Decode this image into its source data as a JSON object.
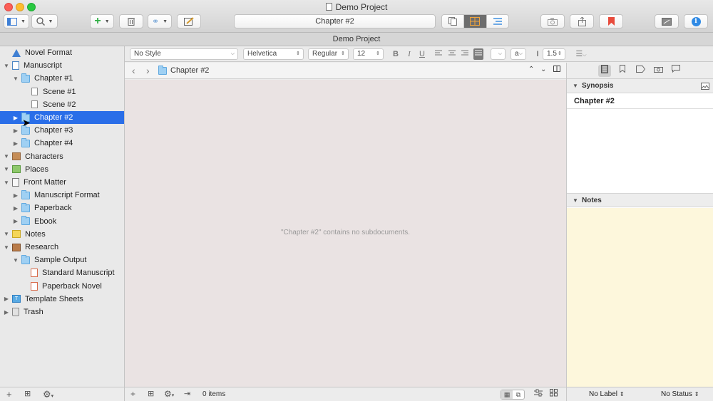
{
  "window": {
    "title": "Demo Project",
    "subtitle": "Demo Project"
  },
  "toolbar": {
    "current_document": "Chapter #2"
  },
  "binder": {
    "items": [
      {
        "label": "Novel Format",
        "icon": "warning-triangle-icon",
        "level": 0,
        "disclosure": ""
      },
      {
        "label": "Manuscript",
        "icon": "manuscript-icon",
        "level": 0,
        "disclosure": "down"
      },
      {
        "label": "Chapter #1",
        "icon": "folder-icon",
        "level": 1,
        "disclosure": "down"
      },
      {
        "label": "Scene #1",
        "icon": "document-icon",
        "level": 2,
        "disclosure": ""
      },
      {
        "label": "Scene #2",
        "icon": "document-icon",
        "level": 2,
        "disclosure": ""
      },
      {
        "label": "Chapter #2",
        "icon": "folder-icon",
        "level": 1,
        "disclosure": "right",
        "selected": true
      },
      {
        "label": "Chapter #3",
        "icon": "folder-icon",
        "level": 1,
        "disclosure": "right"
      },
      {
        "label": "Chapter #4",
        "icon": "folder-icon",
        "level": 1,
        "disclosure": "right"
      },
      {
        "label": "Characters",
        "icon": "characters-icon",
        "level": 0,
        "disclosure": "down"
      },
      {
        "label": "Places",
        "icon": "places-icon",
        "level": 0,
        "disclosure": "down"
      },
      {
        "label": "Front Matter",
        "icon": "front-matter-icon",
        "level": 0,
        "disclosure": "down"
      },
      {
        "label": "Manuscript Format",
        "icon": "folder-icon",
        "level": 1,
        "disclosure": "right"
      },
      {
        "label": "Paperback",
        "icon": "folder-icon",
        "level": 1,
        "disclosure": "right"
      },
      {
        "label": "Ebook",
        "icon": "folder-icon",
        "level": 1,
        "disclosure": "right"
      },
      {
        "label": "Notes",
        "icon": "notes-icon",
        "level": 0,
        "disclosure": "down"
      },
      {
        "label": "Research",
        "icon": "research-icon",
        "level": 0,
        "disclosure": "down"
      },
      {
        "label": "Sample Output",
        "icon": "folder-icon",
        "level": 1,
        "disclosure": "down"
      },
      {
        "label": "Standard Manuscript",
        "icon": "compile-output-icon",
        "level": 2,
        "disclosure": ""
      },
      {
        "label": "Paperback Novel",
        "icon": "compile-output-icon",
        "level": 2,
        "disclosure": ""
      },
      {
        "label": "Template Sheets",
        "icon": "template-sheets-icon",
        "level": 0,
        "disclosure": "right"
      },
      {
        "label": "Trash",
        "icon": "trash-icon",
        "level": 0,
        "disclosure": "right"
      }
    ]
  },
  "formatbar": {
    "style": "No Style",
    "font": "Helvetica",
    "weight": "Regular",
    "size": "12",
    "bold": "B",
    "italic": "I",
    "underline": "U",
    "highlight": "a",
    "line_spacing": "1.5"
  },
  "editor": {
    "breadcrumb": "Chapter #2",
    "empty_message": "\"Chapter #2\" contains no subdocuments.",
    "item_count": "0 items",
    "background": "#eae3e3"
  },
  "inspector": {
    "synopsis_label": "Synopsis",
    "synopsis_title": "Chapter #2",
    "notes_label": "Notes",
    "label_value": "No Label",
    "status_value": "No Status",
    "notes_background": "#fdf7dc"
  },
  "colors": {
    "selection": "#2a6ee8",
    "accent_orange": "#f2a53c",
    "bookmark_red": "#e84b3c",
    "info_blue": "#2f8ae5"
  }
}
